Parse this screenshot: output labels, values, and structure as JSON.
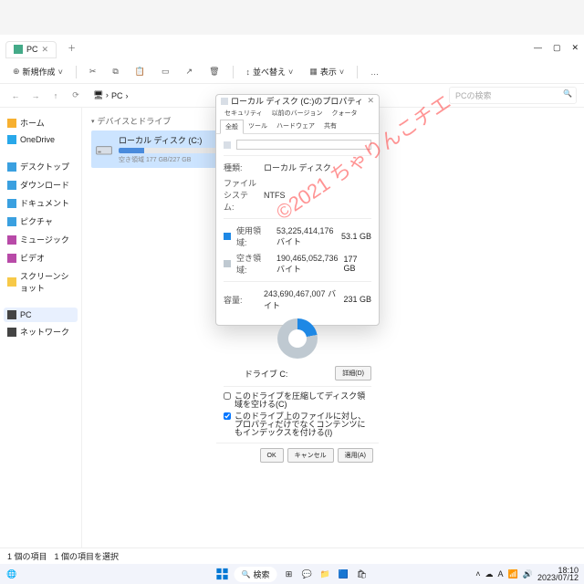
{
  "titlebar": {
    "tab": "PC",
    "plus": "＋"
  },
  "winctl": {
    "min": "—",
    "max": "▢",
    "close": "✕"
  },
  "toolbar": {
    "new": "新規作成",
    "cut": "",
    "copy": "",
    "paste": "",
    "rename": "",
    "share": "",
    "delete": "",
    "sort": "並べ替え",
    "view": "表示",
    "more": "…"
  },
  "addr": {
    "crumb1": "PC",
    "search_ph": "PCの検索"
  },
  "sidebar": {
    "items": [
      {
        "label": "ホーム",
        "color": "#f7b030"
      },
      {
        "label": "OneDrive",
        "color": "#28a8ea"
      },
      {
        "gap": true
      },
      {
        "label": "デスクトップ",
        "color": "#3aa0e0"
      },
      {
        "label": "ダウンロード",
        "color": "#3aa0e0"
      },
      {
        "label": "ドキュメント",
        "color": "#3aa0e0"
      },
      {
        "label": "ピクチャ",
        "color": "#3aa0e0"
      },
      {
        "label": "ミュージック",
        "color": "#b84aa8"
      },
      {
        "label": "ビデオ",
        "color": "#b84aa8"
      },
      {
        "label": "スクリーンショット",
        "color": "#f7c948"
      },
      {
        "gap": true
      },
      {
        "label": "PC",
        "color": "#444",
        "sel": true
      },
      {
        "label": "ネットワーク",
        "color": "#444"
      }
    ]
  },
  "main": {
    "category": "デバイスとドライブ",
    "drive": {
      "name": "ローカル ディスク (C:)",
      "sub": "空き領域 177 GB/227 GB"
    }
  },
  "status": {
    "left": "1 個の項目",
    "right": "1 個の項目を選択"
  },
  "dialog": {
    "title": "ローカル ディスク (C:)のプロパティ",
    "tabs_top": [
      "セキュリティ",
      "以前のバージョン",
      "クォータ"
    ],
    "tabs_bot": [
      "全般",
      "ツール",
      "ハードウェア",
      "共有"
    ],
    "type_l": "種類:",
    "type_v": "ローカル ディスク",
    "fs_l": "ファイル システム:",
    "fs_v": "NTFS",
    "used_l": "使用領域:",
    "used_v": "53,225,414,176 バイト",
    "used_g": "53.1 GB",
    "free_l": "空き領域:",
    "free_v": "190,465,052,736 バイト",
    "free_g": "177 GB",
    "cap_l": "容量:",
    "cap_v": "243,690,467,007 バイト",
    "cap_g": "231 GB",
    "drive_label": "ドライブ C:",
    "cleanup": "詳細(D)",
    "chk1": "このドライブを圧縮してディスク領域を空ける(C)",
    "chk2": "このドライブ上のファイルに対し、プロパティだけでなくコンテンツにもインデックスを付ける(I)",
    "ok": "OK",
    "cancel": "キャンセル",
    "apply": "適用(A)"
  },
  "taskbar": {
    "search": "検索",
    "tray": {
      "time": "18:10",
      "date": "2023/07/12"
    }
  },
  "watermark": "©2021 ちゃりんこチエ",
  "colors": {
    "used": "#1e88e5",
    "free": "#bfc9d1"
  }
}
